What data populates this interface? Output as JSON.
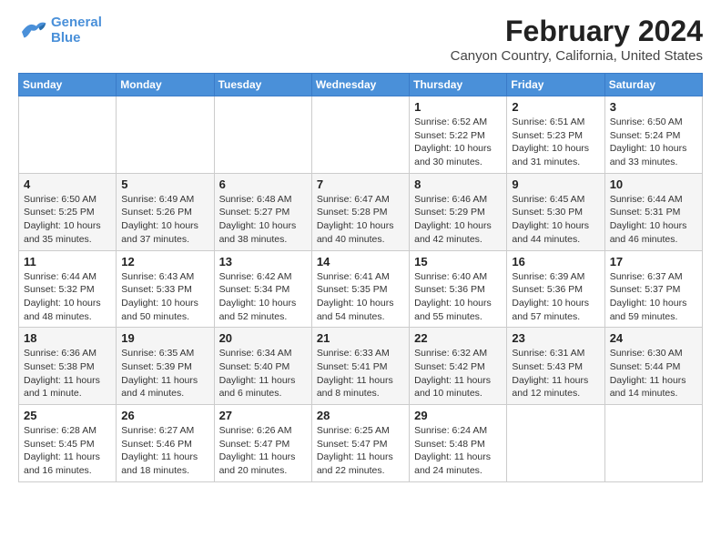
{
  "header": {
    "logo_line1": "General",
    "logo_line2": "Blue",
    "month_year": "February 2024",
    "location": "Canyon Country, California, United States"
  },
  "weekdays": [
    "Sunday",
    "Monday",
    "Tuesday",
    "Wednesday",
    "Thursday",
    "Friday",
    "Saturday"
  ],
  "weeks": [
    [
      {
        "day": "",
        "info": ""
      },
      {
        "day": "",
        "info": ""
      },
      {
        "day": "",
        "info": ""
      },
      {
        "day": "",
        "info": ""
      },
      {
        "day": "1",
        "info": "Sunrise: 6:52 AM\nSunset: 5:22 PM\nDaylight: 10 hours\nand 30 minutes."
      },
      {
        "day": "2",
        "info": "Sunrise: 6:51 AM\nSunset: 5:23 PM\nDaylight: 10 hours\nand 31 minutes."
      },
      {
        "day": "3",
        "info": "Sunrise: 6:50 AM\nSunset: 5:24 PM\nDaylight: 10 hours\nand 33 minutes."
      }
    ],
    [
      {
        "day": "4",
        "info": "Sunrise: 6:50 AM\nSunset: 5:25 PM\nDaylight: 10 hours\nand 35 minutes."
      },
      {
        "day": "5",
        "info": "Sunrise: 6:49 AM\nSunset: 5:26 PM\nDaylight: 10 hours\nand 37 minutes."
      },
      {
        "day": "6",
        "info": "Sunrise: 6:48 AM\nSunset: 5:27 PM\nDaylight: 10 hours\nand 38 minutes."
      },
      {
        "day": "7",
        "info": "Sunrise: 6:47 AM\nSunset: 5:28 PM\nDaylight: 10 hours\nand 40 minutes."
      },
      {
        "day": "8",
        "info": "Sunrise: 6:46 AM\nSunset: 5:29 PM\nDaylight: 10 hours\nand 42 minutes."
      },
      {
        "day": "9",
        "info": "Sunrise: 6:45 AM\nSunset: 5:30 PM\nDaylight: 10 hours\nand 44 minutes."
      },
      {
        "day": "10",
        "info": "Sunrise: 6:44 AM\nSunset: 5:31 PM\nDaylight: 10 hours\nand 46 minutes."
      }
    ],
    [
      {
        "day": "11",
        "info": "Sunrise: 6:44 AM\nSunset: 5:32 PM\nDaylight: 10 hours\nand 48 minutes."
      },
      {
        "day": "12",
        "info": "Sunrise: 6:43 AM\nSunset: 5:33 PM\nDaylight: 10 hours\nand 50 minutes."
      },
      {
        "day": "13",
        "info": "Sunrise: 6:42 AM\nSunset: 5:34 PM\nDaylight: 10 hours\nand 52 minutes."
      },
      {
        "day": "14",
        "info": "Sunrise: 6:41 AM\nSunset: 5:35 PM\nDaylight: 10 hours\nand 54 minutes."
      },
      {
        "day": "15",
        "info": "Sunrise: 6:40 AM\nSunset: 5:36 PM\nDaylight: 10 hours\nand 55 minutes."
      },
      {
        "day": "16",
        "info": "Sunrise: 6:39 AM\nSunset: 5:36 PM\nDaylight: 10 hours\nand 57 minutes."
      },
      {
        "day": "17",
        "info": "Sunrise: 6:37 AM\nSunset: 5:37 PM\nDaylight: 10 hours\nand 59 minutes."
      }
    ],
    [
      {
        "day": "18",
        "info": "Sunrise: 6:36 AM\nSunset: 5:38 PM\nDaylight: 11 hours\nand 1 minute."
      },
      {
        "day": "19",
        "info": "Sunrise: 6:35 AM\nSunset: 5:39 PM\nDaylight: 11 hours\nand 4 minutes."
      },
      {
        "day": "20",
        "info": "Sunrise: 6:34 AM\nSunset: 5:40 PM\nDaylight: 11 hours\nand 6 minutes."
      },
      {
        "day": "21",
        "info": "Sunrise: 6:33 AM\nSunset: 5:41 PM\nDaylight: 11 hours\nand 8 minutes."
      },
      {
        "day": "22",
        "info": "Sunrise: 6:32 AM\nSunset: 5:42 PM\nDaylight: 11 hours\nand 10 minutes."
      },
      {
        "day": "23",
        "info": "Sunrise: 6:31 AM\nSunset: 5:43 PM\nDaylight: 11 hours\nand 12 minutes."
      },
      {
        "day": "24",
        "info": "Sunrise: 6:30 AM\nSunset: 5:44 PM\nDaylight: 11 hours\nand 14 minutes."
      }
    ],
    [
      {
        "day": "25",
        "info": "Sunrise: 6:28 AM\nSunset: 5:45 PM\nDaylight: 11 hours\nand 16 minutes."
      },
      {
        "day": "26",
        "info": "Sunrise: 6:27 AM\nSunset: 5:46 PM\nDaylight: 11 hours\nand 18 minutes."
      },
      {
        "day": "27",
        "info": "Sunrise: 6:26 AM\nSunset: 5:47 PM\nDaylight: 11 hours\nand 20 minutes."
      },
      {
        "day": "28",
        "info": "Sunrise: 6:25 AM\nSunset: 5:47 PM\nDaylight: 11 hours\nand 22 minutes."
      },
      {
        "day": "29",
        "info": "Sunrise: 6:24 AM\nSunset: 5:48 PM\nDaylight: 11 hours\nand 24 minutes."
      },
      {
        "day": "",
        "info": ""
      },
      {
        "day": "",
        "info": ""
      }
    ]
  ]
}
